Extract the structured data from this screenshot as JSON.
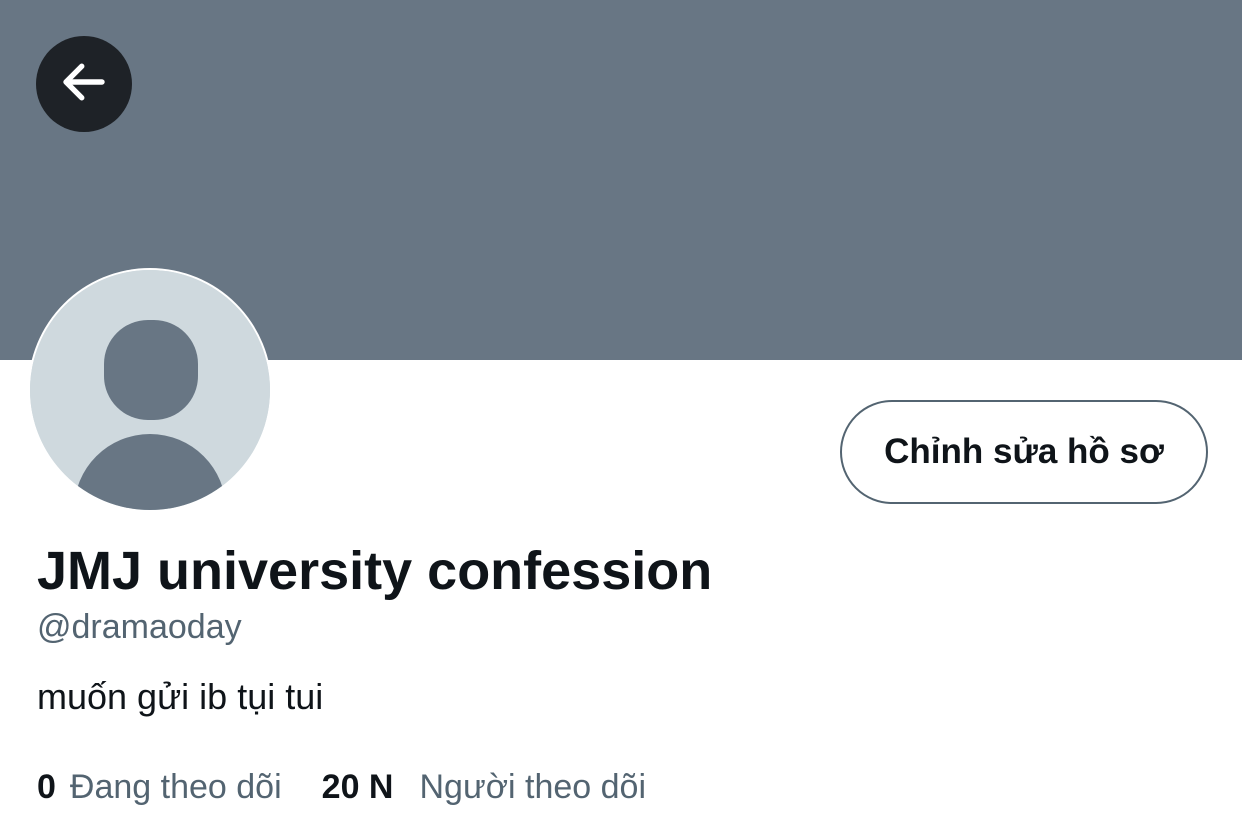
{
  "header": {
    "banner_color": "#687684",
    "back_icon": "arrow-left-icon"
  },
  "profile": {
    "avatar_icon": "default-avatar-icon",
    "edit_button_label": "Chỉnh sửa hồ sơ",
    "display_name": "JMJ university confession",
    "handle": "@dramaoday",
    "bio": "muốn gửi ib tụi tui"
  },
  "stats": {
    "following_count": "0",
    "following_label": "Đang theo dõi",
    "followers_count": "20 N",
    "followers_label": "Người theo dõi"
  },
  "colors": {
    "text_primary": "#0f1419",
    "text_secondary": "#536471",
    "avatar_bg": "#cfd9de",
    "back_button_bg": "#1e2227"
  }
}
